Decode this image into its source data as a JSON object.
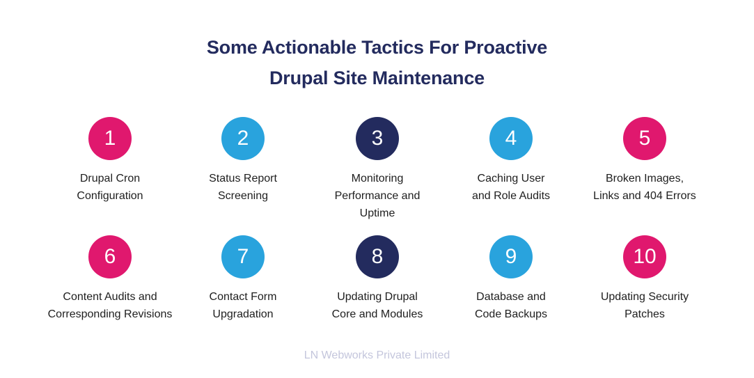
{
  "title": {
    "line1": "Some Actionable Tactics For Proactive",
    "line2": "Drupal Site Maintenance"
  },
  "colors": {
    "title": "#232b5e",
    "pink": "#e0186e",
    "blue": "#29a3dd",
    "navy": "#232b5e",
    "label": "#1e1e1e",
    "footer": "#c4c6dc"
  },
  "items": [
    {
      "number": "1",
      "color": "#e0186e",
      "lines": [
        "Drupal Cron",
        "Configuration"
      ]
    },
    {
      "number": "2",
      "color": "#29a3dd",
      "lines": [
        "Status Report",
        "Screening"
      ]
    },
    {
      "number": "3",
      "color": "#232b5e",
      "lines": [
        "Monitoring",
        "Performance and",
        "Uptime"
      ]
    },
    {
      "number": "4",
      "color": "#29a3dd",
      "lines": [
        "Caching User",
        "and Role Audits"
      ]
    },
    {
      "number": "5",
      "color": "#e0186e",
      "lines": [
        "Broken Images,",
        "Links and 404 Errors"
      ]
    },
    {
      "number": "6",
      "color": "#e0186e",
      "lines": [
        "Content Audits and",
        "Corresponding Revisions"
      ]
    },
    {
      "number": "7",
      "color": "#29a3dd",
      "lines": [
        "Contact Form",
        "Upgradation"
      ]
    },
    {
      "number": "8",
      "color": "#232b5e",
      "lines": [
        "Updating Drupal",
        "Core and Modules"
      ]
    },
    {
      "number": "9",
      "color": "#29a3dd",
      "lines": [
        "Database and",
        "Code Backups"
      ]
    },
    {
      "number": "10",
      "color": "#e0186e",
      "lines": [
        "Updating Security",
        "Patches"
      ]
    }
  ],
  "footer": "LN Webworks Private Limited"
}
